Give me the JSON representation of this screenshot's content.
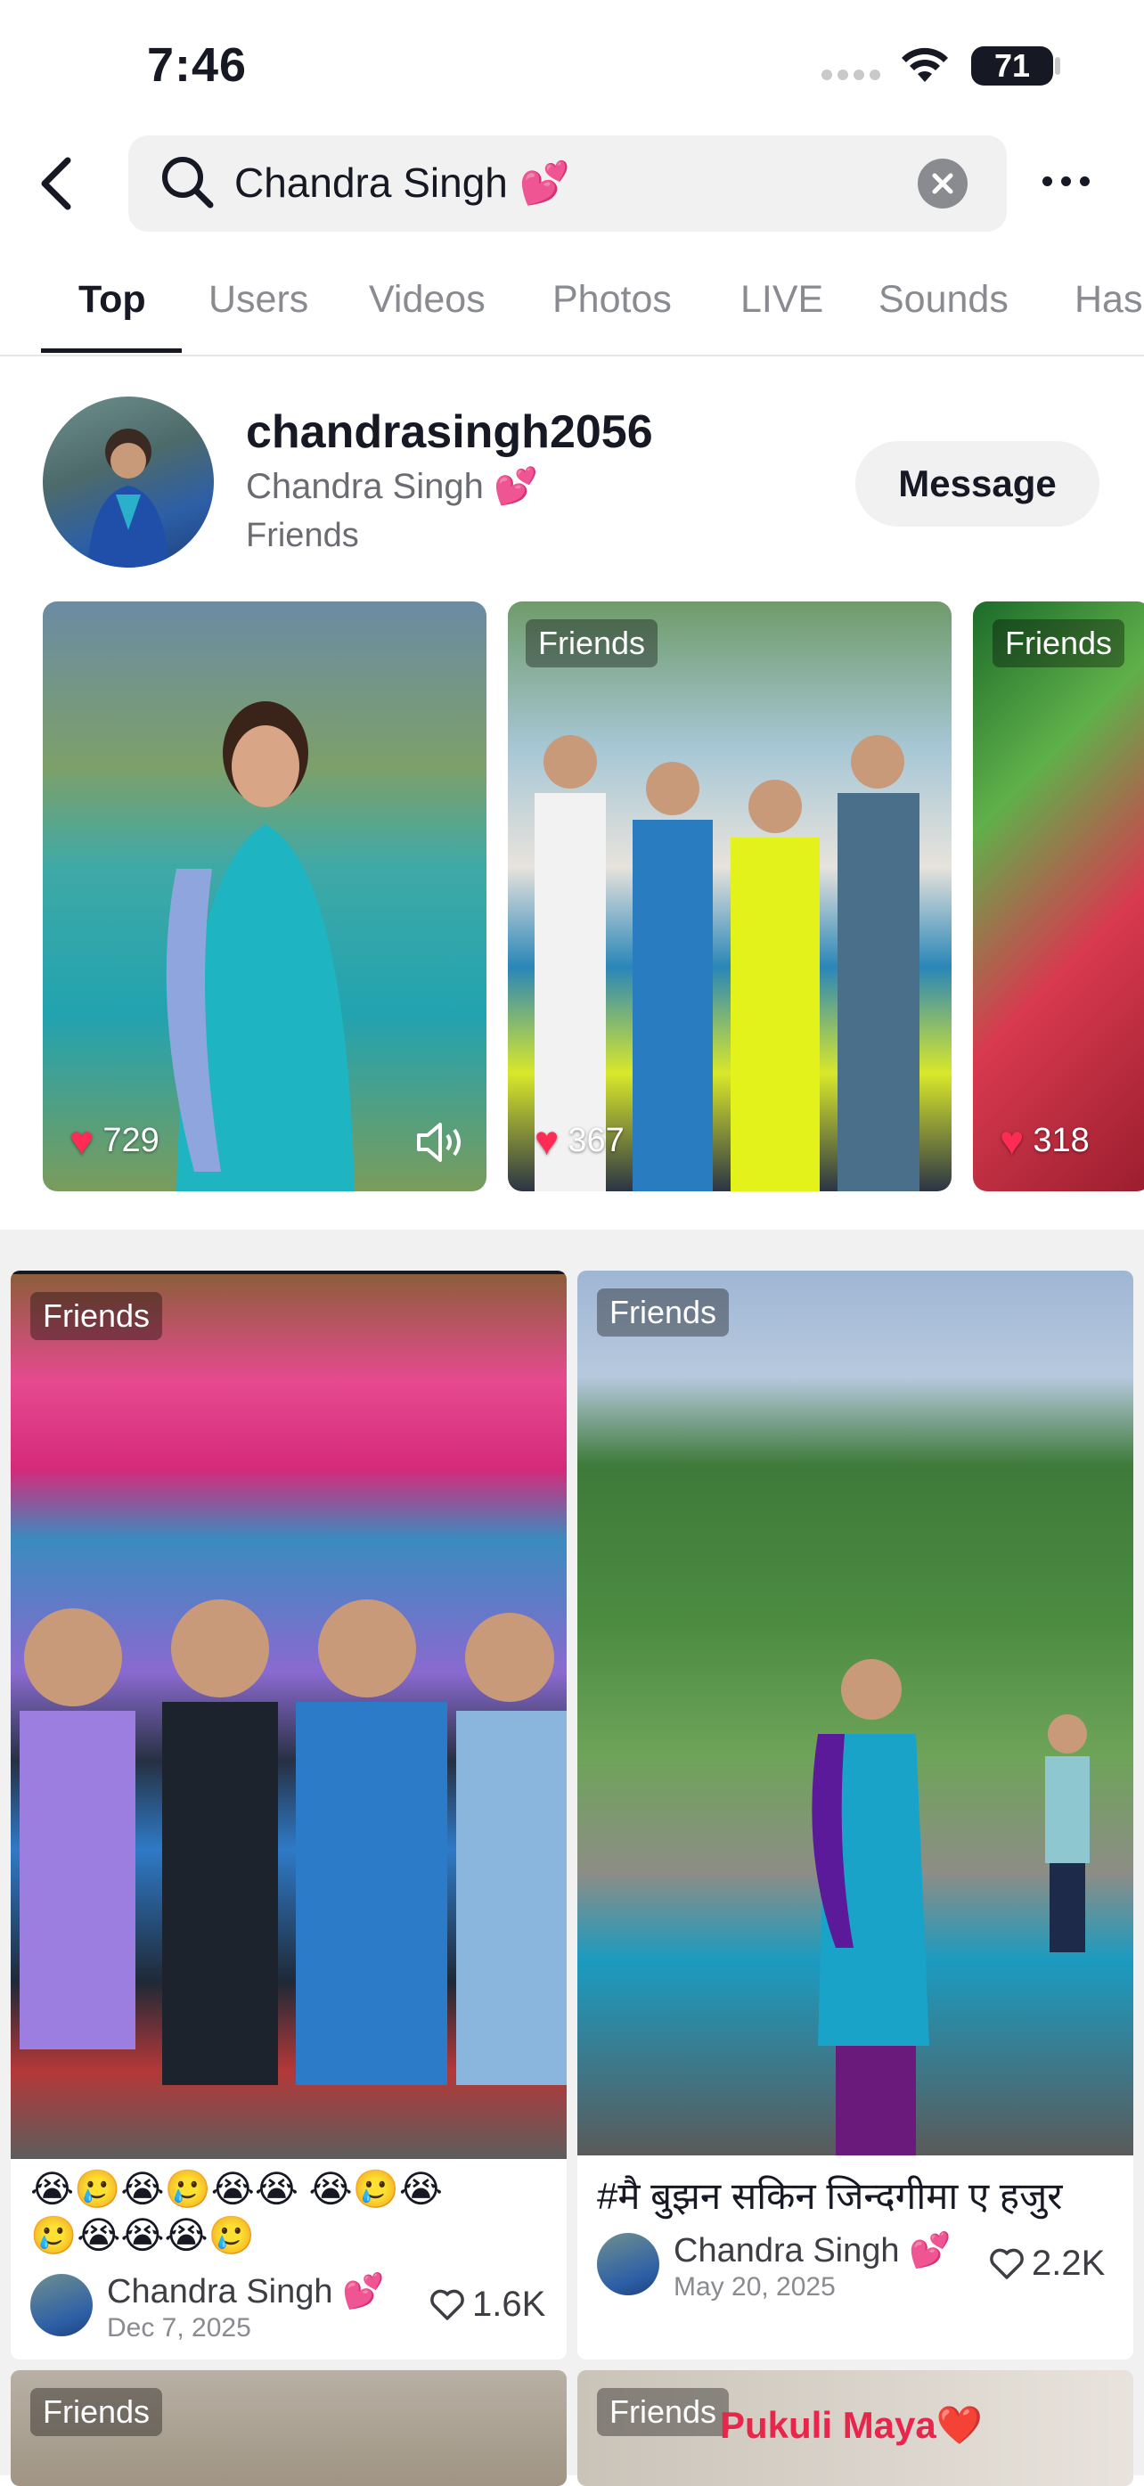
{
  "status_bar": {
    "time": "7:46",
    "battery": "71"
  },
  "search": {
    "query": "Chandra Singh 💕"
  },
  "tabs": [
    {
      "label": "Top"
    },
    {
      "label": "Users"
    },
    {
      "label": "Videos"
    },
    {
      "label": "Photos"
    },
    {
      "label": "LIVE"
    },
    {
      "label": "Sounds"
    },
    {
      "label": "Has"
    }
  ],
  "user": {
    "username": "chandrasingh2056",
    "display_name": "Chandra Singh 💕",
    "relation": "Friends",
    "message_label": "Message"
  },
  "carousel": [
    {
      "likes": "729",
      "badge": ""
    },
    {
      "likes": "367",
      "badge": "Friends"
    },
    {
      "likes": "318",
      "badge": "Friends"
    }
  ],
  "grid": [
    {
      "badge": "Friends",
      "caption_line1": "😭🥲😭🥲😭😭 😭🥲😭",
      "caption_line2": "🥲😭😭😭🥲",
      "author": "Chandra Singh 💕",
      "date": "Dec 7, 2025",
      "likes": "1.6K"
    },
    {
      "badge": "Friends",
      "caption_line1": "#मै बुझन सकिन जिन्दगीमा ए हजुर",
      "author": "Chandra Singh 💕",
      "date": "May 20, 2025",
      "likes": "2.2K"
    },
    {
      "badge": "Friends"
    },
    {
      "badge": "Friends",
      "overlay_text": "Pukuli Maya❤️"
    }
  ],
  "colors": {
    "like_red": "#fe2c55",
    "text": "#161823",
    "muted": "#8a8b91"
  }
}
